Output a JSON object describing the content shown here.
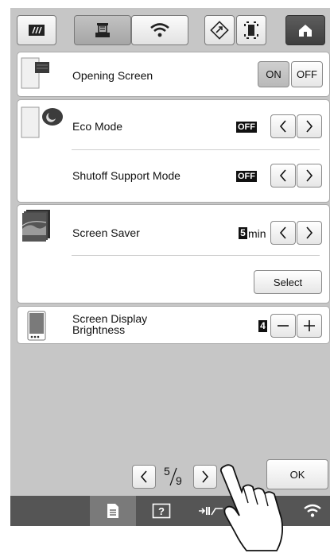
{
  "toolbar": {
    "tabs": [
      {
        "icon": "utility-icon"
      },
      {
        "icon": "machine-icon"
      },
      {
        "icon": "wifi-icon"
      },
      {
        "icon": "diamond-arrow-icon"
      },
      {
        "icon": "frame-icon"
      },
      {
        "icon": "home-icon"
      }
    ],
    "active_tab": 1
  },
  "settings": {
    "opening_screen": {
      "label": "Opening Screen",
      "on_label": "ON",
      "off_label": "OFF",
      "selected": "ON"
    },
    "eco_mode": {
      "label": "Eco Mode",
      "value": "OFF"
    },
    "shutoff_support": {
      "label": "Shutoff Support Mode",
      "value": "OFF"
    },
    "screen_saver": {
      "label": "Screen Saver",
      "value": "5",
      "unit": "min",
      "select_label": "Select"
    },
    "brightness": {
      "label_line1": "Screen Display",
      "label_line2": "Brightness",
      "value": "4"
    }
  },
  "pager": {
    "current": "5",
    "total": "9"
  },
  "ok_label": "OK",
  "colors": {
    "background": "#c6c6c6",
    "panel": "#ffffff",
    "bottom_bar": "#555555",
    "home_button": "#454545"
  }
}
